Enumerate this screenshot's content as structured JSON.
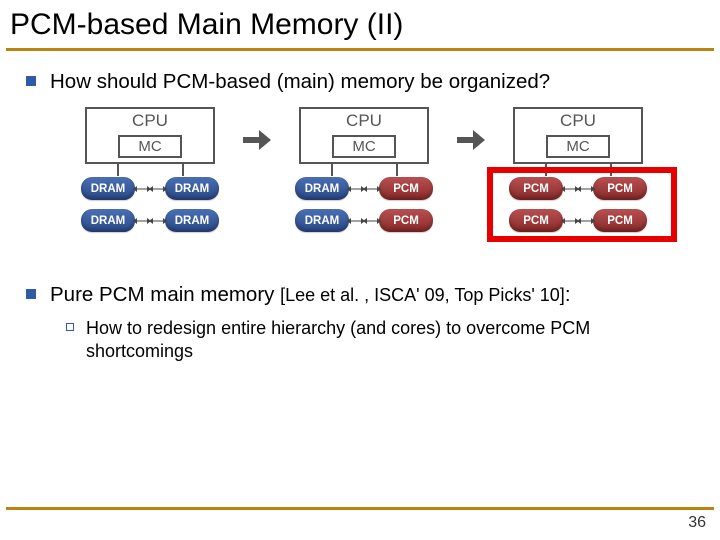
{
  "title": "PCM-based Main Memory (II)",
  "bullets": {
    "q": "How should PCM-based (main) memory be organized?",
    "pure_prefix": "Pure PCM main memory ",
    "pure_cite": "[Lee et al. , ISCA' 09, Top Picks' 10]",
    "pure_suffix": ":",
    "sub": "How to redesign entire hierarchy (and cores) to overcome PCM shortcomings"
  },
  "diagram": {
    "cpu": "CPU",
    "mc": "MC",
    "dram": "DRAM",
    "pcm": "PCM",
    "archs": [
      {
        "mems": [
          [
            "dram",
            "dram"
          ],
          [
            "dram",
            "dram"
          ]
        ],
        "highlight": false
      },
      {
        "mems": [
          [
            "dram",
            "pcm"
          ],
          [
            "dram",
            "pcm"
          ]
        ],
        "highlight": false
      },
      {
        "mems": [
          [
            "pcm",
            "pcm"
          ],
          [
            "pcm",
            "pcm"
          ]
        ],
        "highlight": true
      }
    ]
  },
  "page_number": "36"
}
